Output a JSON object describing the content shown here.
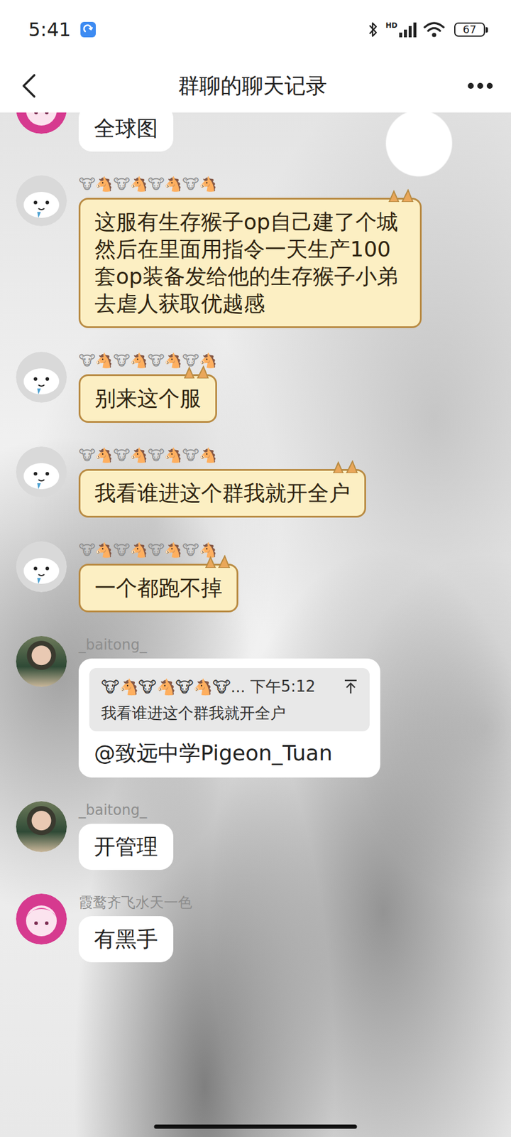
{
  "status_bar": {
    "time": "5:41",
    "network": "HD",
    "battery": "67"
  },
  "header": {
    "title": "群聊的聊天记录"
  },
  "messages": [
    {
      "sender": "",
      "avatar": "pink",
      "kind": "plain",
      "text": "全球图"
    },
    {
      "sender": "🐮🐴🐮🐴🐮🐴🐮🐴",
      "avatar": "seal",
      "kind": "theme",
      "text": "这服有生存猴子op自己建了个城然后在里面用指令一天生产100套op装备发给他的生存猴子小弟去虐人获取优越感"
    },
    {
      "sender": "🐮🐴🐮🐴🐮🐴🐮🐴",
      "avatar": "seal",
      "kind": "theme",
      "text": "别来这个服"
    },
    {
      "sender": "🐮🐴🐮🐴🐮🐴🐮🐴",
      "avatar": "seal",
      "kind": "theme",
      "text": "我看谁进这个群我就开全户"
    },
    {
      "sender": "🐮🐴🐮🐴🐮🐴🐮🐴",
      "avatar": "seal",
      "kind": "theme",
      "text": "一个都跑不掉"
    },
    {
      "sender": "_baitong_",
      "avatar": "photo",
      "kind": "reply",
      "quote": {
        "sender": "🐮🐴🐮🐴🐮🐴🐮...",
        "time": "下午5:12",
        "text": "我看谁进这个群我就开全户"
      },
      "text": "@致远中学Pigeon_Tuan"
    },
    {
      "sender": "_baitong_",
      "avatar": "photo",
      "kind": "plain",
      "text": "开管理"
    },
    {
      "sender": "霞鹜齐飞水天一色",
      "avatar": "pink",
      "kind": "plain",
      "text": "有黑手"
    }
  ]
}
